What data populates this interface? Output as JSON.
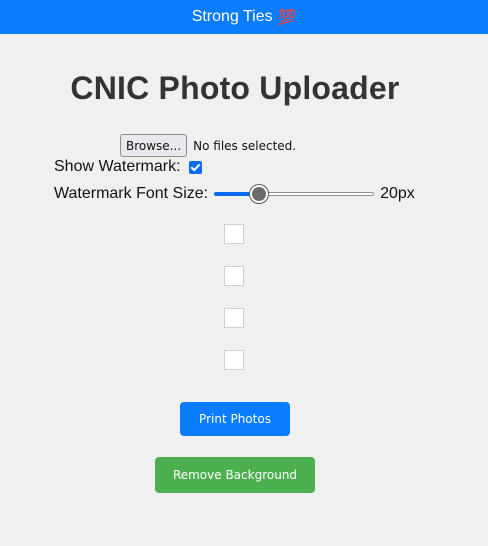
{
  "topbar": {
    "brand": "Strong Ties",
    "emoji": "💯"
  },
  "page": {
    "title": "CNIC Photo Uploader"
  },
  "file_input": {
    "button_label": "Browse...",
    "status": "No files selected."
  },
  "watermark": {
    "show_label": "Show Watermark:",
    "show_checked": true,
    "font_size_label": "Watermark Font Size:",
    "font_size_value": "20px",
    "slider_fraction": 0.28
  },
  "photo_slots": [
    {
      "name": "photo-slot-1"
    },
    {
      "name": "photo-slot-2"
    },
    {
      "name": "photo-slot-3"
    },
    {
      "name": "photo-slot-4"
    }
  ],
  "actions": {
    "print_label": "Print Photos",
    "remove_bg_label": "Remove Background"
  },
  "colors": {
    "primary": "#0a7cff",
    "success": "#4caf50",
    "background": "#f0f0f0"
  }
}
